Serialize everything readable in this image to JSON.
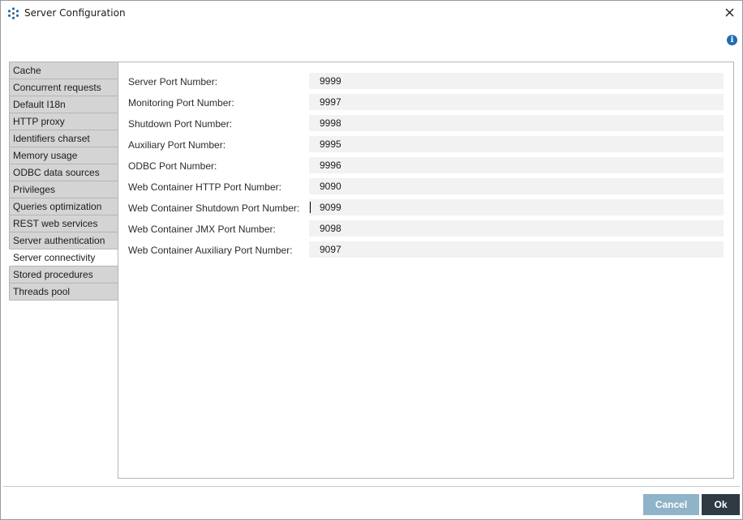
{
  "window": {
    "title": "Server Configuration",
    "info_icon_glyph": "i",
    "icons": {
      "app": "app-logo-icon",
      "close": "close-icon",
      "info": "info-icon"
    },
    "colors": {
      "accent": "#1f6db4",
      "cancel_button": "#8fb3c9",
      "ok_button": "#2e3a44",
      "sidebar_item": "#d4d4d4",
      "input_background": "#f2f2f2"
    }
  },
  "sidebar": {
    "active_index": 11,
    "items": [
      {
        "label": "Cache"
      },
      {
        "label": "Concurrent requests"
      },
      {
        "label": "Default I18n"
      },
      {
        "label": "HTTP proxy"
      },
      {
        "label": "Identifiers charset"
      },
      {
        "label": "Memory usage"
      },
      {
        "label": "ODBC data sources"
      },
      {
        "label": "Privileges"
      },
      {
        "label": "Queries optimization"
      },
      {
        "label": "REST web services"
      },
      {
        "label": "Server authentication"
      },
      {
        "label": "Server connectivity"
      },
      {
        "label": "Stored procedures"
      },
      {
        "label": "Threads pool"
      }
    ]
  },
  "fields": [
    {
      "label": "Server Port Number:",
      "value": "9999"
    },
    {
      "label": "Monitoring Port Number:",
      "value": "9997"
    },
    {
      "label": "Shutdown Port Number:",
      "value": "9998"
    },
    {
      "label": "Auxiliary Port Number:",
      "value": "9995"
    },
    {
      "label": "ODBC Port Number:",
      "value": "9996"
    },
    {
      "label": "Web Container HTTP Port Number:",
      "value": "9090"
    },
    {
      "label": "Web Container Shutdown Port Number:",
      "value": "9099"
    },
    {
      "label": "Web Container JMX Port Number:",
      "value": "9098"
    },
    {
      "label": "Web Container Auxiliary Port Number:",
      "value": "9097"
    }
  ],
  "focused_field_index": 6,
  "buttons": {
    "cancel_label": "Cancel",
    "ok_label": "Ok"
  }
}
